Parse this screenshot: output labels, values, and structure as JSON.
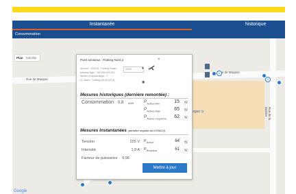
{
  "nav": {
    "active_tab": "Instantanée",
    "history_tab": "historique",
    "subtitle": "Consommation"
  },
  "map": {
    "plan_label": "Plan",
    "satellite_label": "Satellite",
    "road_left": "Rue de Maupas",
    "road_right": "Rue de Maupas",
    "road_vertical": "Rue de la Balette",
    "point_label": "K Sogeo",
    "google": "Google",
    "marker_numbers": [
      "8",
      "8",
      "4"
    ]
  },
  "popup": {
    "title": "Point lumineux : Parking Nord 2",
    "close": "×",
    "info_lines": [
      "Armoire : LEDLIS - Parking Sogeo",
      "Adresse logic : 182.169.100.204",
      "Numéro d'appareillage : 7",
      "Cr. Alarm : Parking (2019/12/13)"
    ],
    "select_value": "100%",
    "historical": {
      "title": "Mesures historiques (dernière remontée) :",
      "consumption_label": "Consommation",
      "consumption_value": "0,8",
      "consumption_unit": "kWh",
      "rows": [
        {
          "p": "P",
          "sub": "Active Min",
          "value": "15",
          "unit": "W"
        },
        {
          "p": "P",
          "sub": "Active Max",
          "value": "65",
          "unit": "W"
        },
        {
          "p": "P",
          "sub": "Active moyenne",
          "value": "62",
          "unit": "W"
        }
      ]
    },
    "instant": {
      "title": "Mesures Instantanées",
      "note": "(dernière requête du 07/06/23)",
      "rows": [
        {
          "label": "Tension",
          "value": "225 V",
          "p": "P",
          "sub": "Active",
          "pvalue": "64",
          "punit": "W"
        },
        {
          "label": "Intensité",
          "value": "1,9 A",
          "p": "P",
          "sub": "Réactive",
          "pvalue": "61",
          "punit": "W"
        },
        {
          "label": "Facteur de puissance",
          "value": "0,96",
          "p": "",
          "sub": "",
          "pvalue": "",
          "punit": ""
        }
      ]
    },
    "update_button": "Mettre à jour"
  },
  "colors": {
    "nav_bg": "#1a4e8f",
    "accent_yellow": "#ffd91a",
    "underline": "#e05a28",
    "button": "#2b78c9"
  }
}
